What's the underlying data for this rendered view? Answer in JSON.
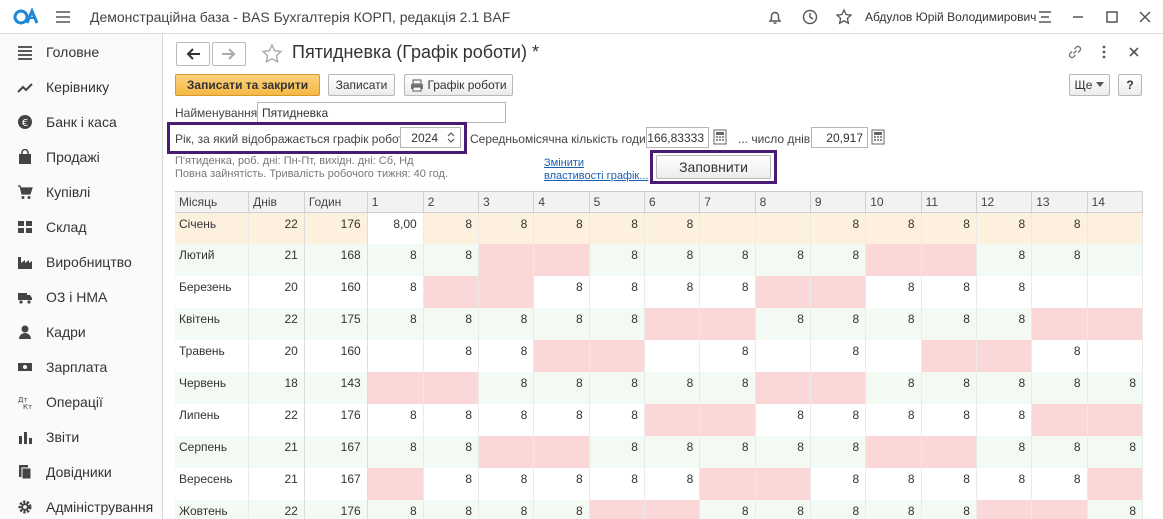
{
  "app": {
    "title": "Демонстраційна база - BAS Бухгалтерія КОРП, редакція 2.1 BAF",
    "user": "Абдулов Юрій Володимирович"
  },
  "sidebar": {
    "items": [
      {
        "label": "Головне",
        "icon": "menu-lines-icon"
      },
      {
        "label": "Керівнику",
        "icon": "trend-icon"
      },
      {
        "label": "Банк і каса",
        "icon": "coin-icon"
      },
      {
        "label": "Продажі",
        "icon": "bag-icon"
      },
      {
        "label": "Купівлі",
        "icon": "cart-icon"
      },
      {
        "label": "Склад",
        "icon": "warehouse-icon"
      },
      {
        "label": "Виробництво",
        "icon": "factory-icon"
      },
      {
        "label": "ОЗ і НМА",
        "icon": "truck-icon"
      },
      {
        "label": "Кадри",
        "icon": "person-icon"
      },
      {
        "label": "Зарплата",
        "icon": "money-icon"
      },
      {
        "label": "Операції",
        "icon": "dt-kt-icon"
      },
      {
        "label": "Звіти",
        "icon": "bar-chart-icon"
      },
      {
        "label": "Довідники",
        "icon": "books-icon"
      },
      {
        "label": "Адміністрування",
        "icon": "gear-icon"
      }
    ]
  },
  "form": {
    "title": "Пятидневка (Графік роботи) *",
    "buttons": {
      "save_close": "Записати та закрити",
      "save": "Записати",
      "schedule": "Графік роботи",
      "more": "Ще",
      "help": "?",
      "fill": "Заповнити"
    },
    "name_label": "Найменування:",
    "name_value": "Пятидневка",
    "year_label": "Рік, за який відображається графік роботи:",
    "year_value": "2024",
    "avg_hours_label": "Середньомісячна кількість годин:",
    "avg_hours_value": "166,83333",
    "days_label": "... число днів:",
    "days_value": "20,917",
    "info_line1": "П'ятиденка, роб. дні: Пн-Пт, вихідн. дні: Сб, Нд",
    "info_line2": "Повна зайнятість. Тривалість робочого тижня: 40 год.",
    "change_link_1": "Змінити",
    "change_link_2": "властивості графік..."
  },
  "grid": {
    "headers": [
      "Місяць",
      "Днів",
      "Годин",
      "1",
      "2",
      "3",
      "4",
      "5",
      "6",
      "7",
      "8",
      "9",
      "10",
      "11",
      "12",
      "13",
      "14"
    ],
    "rows": [
      {
        "month": "Січень",
        "days": "22",
        "hours": "176",
        "cells": [
          "8,00",
          "8",
          "8",
          "8",
          "8",
          "8",
          "",
          "",
          "8",
          "8",
          "8",
          "8",
          "8",
          ""
        ],
        "off": [
          false,
          false,
          false,
          false,
          false,
          false,
          false,
          false,
          false,
          false,
          false,
          false,
          false,
          false
        ]
      },
      {
        "month": "Лютий",
        "days": "21",
        "hours": "168",
        "cells": [
          "8",
          "8",
          "",
          "",
          "8",
          "8",
          "8",
          "8",
          "8",
          "",
          "",
          "8",
          "8",
          ""
        ],
        "off": [
          false,
          false,
          true,
          true,
          false,
          false,
          false,
          false,
          false,
          true,
          true,
          false,
          false,
          false
        ]
      },
      {
        "month": "Березень",
        "days": "20",
        "hours": "160",
        "cells": [
          "8",
          "",
          "",
          "8",
          "8",
          "8",
          "8",
          "",
          "",
          "8",
          "8",
          "8",
          "",
          ""
        ],
        "off": [
          false,
          true,
          true,
          false,
          false,
          false,
          false,
          true,
          true,
          false,
          false,
          false,
          false,
          false
        ]
      },
      {
        "month": "Квітень",
        "days": "22",
        "hours": "175",
        "cells": [
          "8",
          "8",
          "8",
          "8",
          "8",
          "",
          "",
          "8",
          "8",
          "8",
          "8",
          "8",
          "",
          ""
        ],
        "off": [
          false,
          false,
          false,
          false,
          false,
          true,
          true,
          false,
          false,
          false,
          false,
          false,
          true,
          true
        ]
      },
      {
        "month": "Травень",
        "days": "20",
        "hours": "160",
        "cells": [
          "",
          "8",
          "8",
          "",
          "",
          "",
          "8",
          "",
          "8",
          "",
          "",
          "",
          "8",
          ""
        ],
        "off": [
          false,
          false,
          false,
          true,
          true,
          false,
          false,
          false,
          false,
          false,
          true,
          true,
          false,
          false
        ]
      },
      {
        "month": "Червень",
        "days": "18",
        "hours": "143",
        "cells": [
          "",
          "",
          "8",
          "8",
          "8",
          "8",
          "8",
          "",
          "",
          "8",
          "8",
          "8",
          "8",
          "8"
        ],
        "off": [
          true,
          true,
          false,
          false,
          false,
          false,
          false,
          true,
          true,
          false,
          false,
          false,
          false,
          false
        ]
      },
      {
        "month": "Липень",
        "days": "22",
        "hours": "176",
        "cells": [
          "8",
          "8",
          "8",
          "8",
          "8",
          "",
          "",
          "8",
          "8",
          "8",
          "8",
          "8",
          "",
          ""
        ],
        "off": [
          false,
          false,
          false,
          false,
          false,
          true,
          true,
          false,
          false,
          false,
          false,
          false,
          true,
          true
        ]
      },
      {
        "month": "Серпень",
        "days": "21",
        "hours": "167",
        "cells": [
          "8",
          "8",
          "",
          "",
          "8",
          "8",
          "8",
          "8",
          "8",
          "",
          "",
          "8",
          "8",
          "8"
        ],
        "off": [
          false,
          false,
          true,
          true,
          false,
          false,
          false,
          false,
          false,
          true,
          true,
          false,
          false,
          false
        ]
      },
      {
        "month": "Вересень",
        "days": "21",
        "hours": "167",
        "cells": [
          "",
          "8",
          "8",
          "8",
          "8",
          "8",
          "",
          "",
          "8",
          "8",
          "8",
          "8",
          "8",
          ""
        ],
        "off": [
          true,
          false,
          false,
          false,
          false,
          false,
          true,
          true,
          false,
          false,
          false,
          false,
          false,
          true
        ]
      },
      {
        "month": "Жовтень",
        "days": "22",
        "hours": "176",
        "cells": [
          "8",
          "8",
          "8",
          "8",
          "",
          "",
          "8",
          "8",
          "8",
          "8",
          "8",
          "",
          "",
          "8"
        ],
        "off": [
          false,
          false,
          false,
          false,
          true,
          true,
          false,
          false,
          false,
          false,
          false,
          true,
          true,
          false
        ]
      }
    ]
  }
}
